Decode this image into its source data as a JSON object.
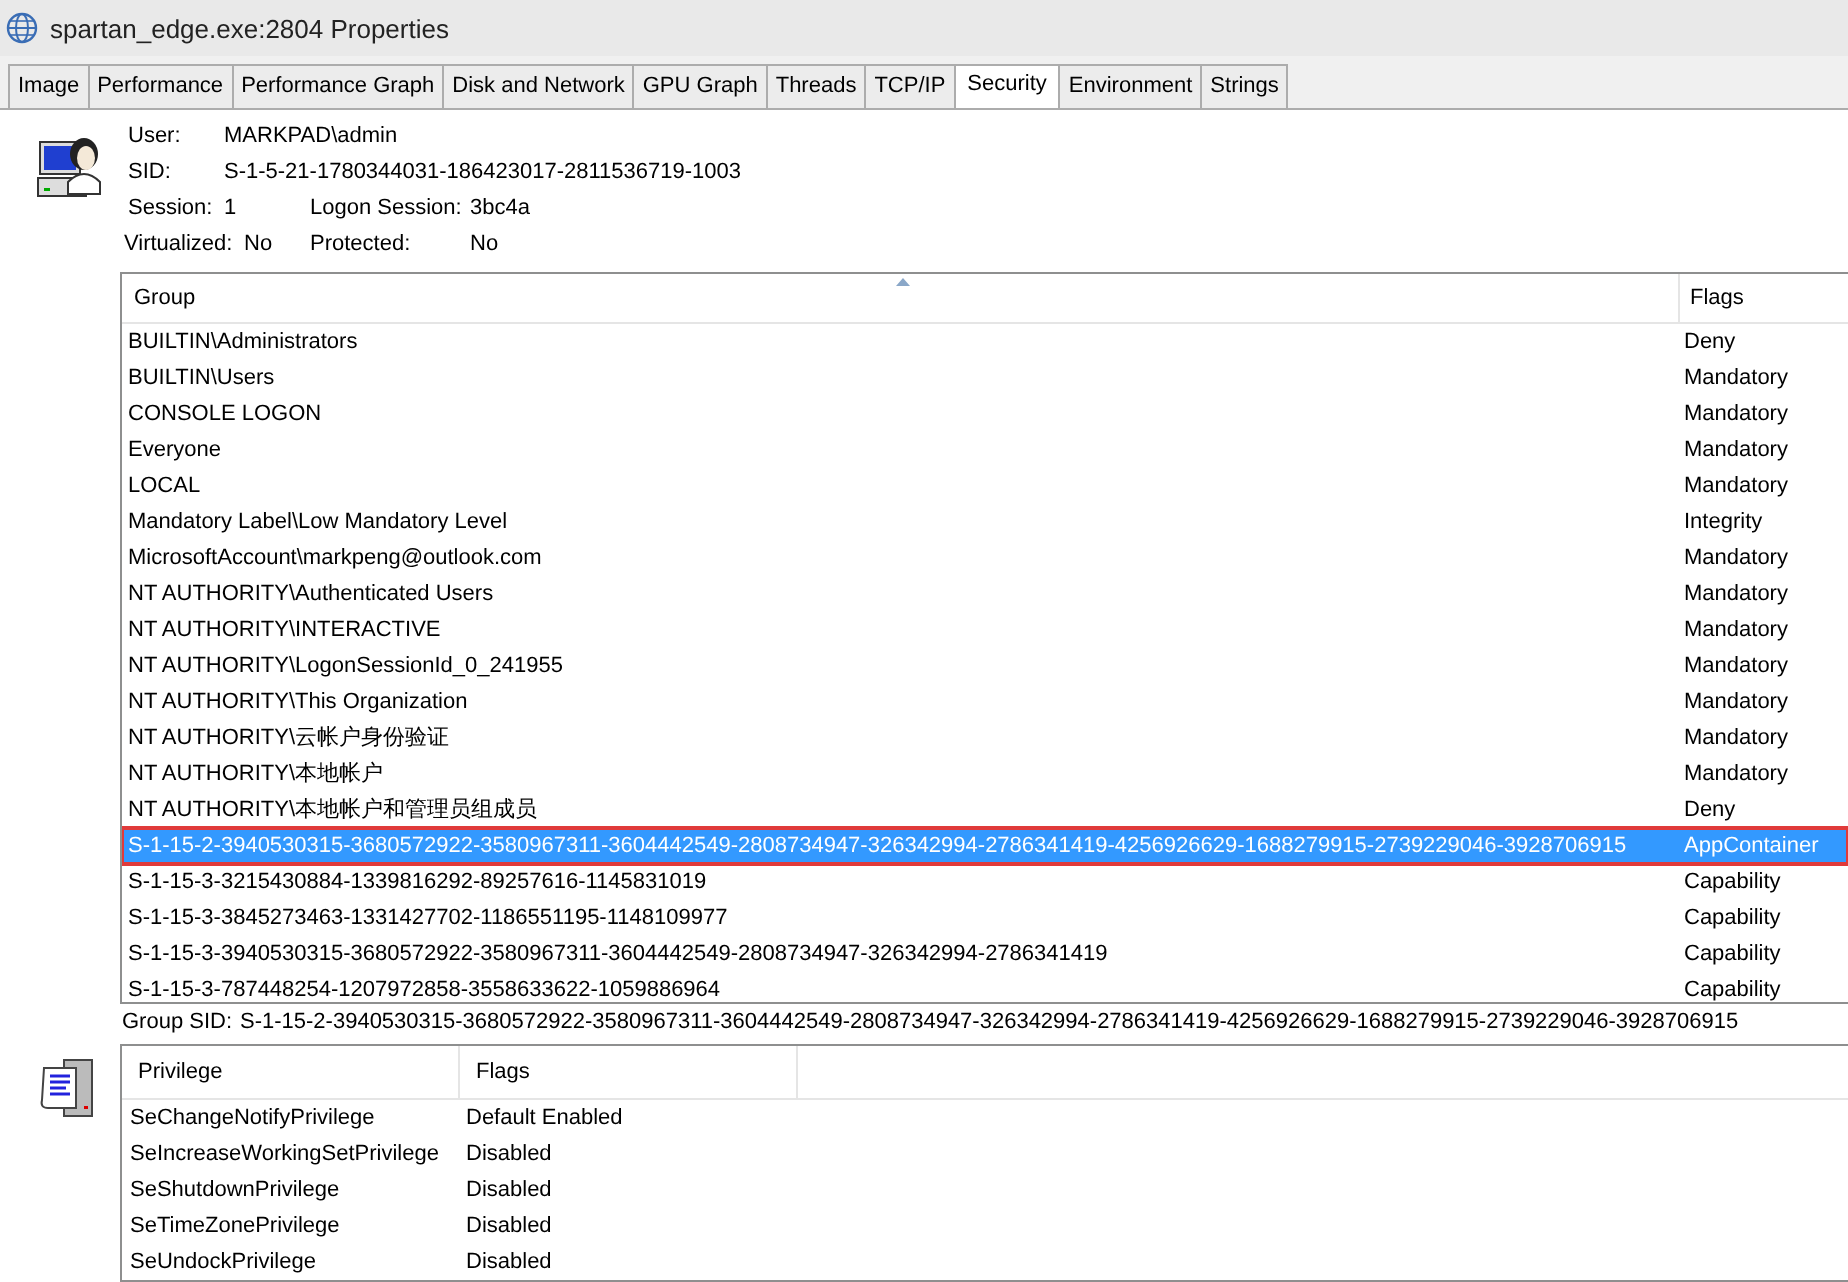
{
  "window": {
    "title": "spartan_edge.exe:2804 Properties"
  },
  "tabs": [
    {
      "label": "Image",
      "selected": false
    },
    {
      "label": "Performance",
      "selected": false
    },
    {
      "label": "Performance Graph",
      "selected": false
    },
    {
      "label": "Disk and Network",
      "selected": false
    },
    {
      "label": "GPU Graph",
      "selected": false
    },
    {
      "label": "Threads",
      "selected": false
    },
    {
      "label": "TCP/IP",
      "selected": false
    },
    {
      "label": "Security",
      "selected": true
    },
    {
      "label": "Environment",
      "selected": false
    },
    {
      "label": "Strings",
      "selected": false
    }
  ],
  "info": {
    "user_label": "User:",
    "user": "MARKPAD\\admin",
    "sid_label": "SID:",
    "sid": "S-1-5-21-1780344031-186423017-2811536719-1003",
    "session_label": "Session:",
    "session": "1",
    "logon_label": "Logon Session:",
    "logon": "3bc4a",
    "virtualized_label": "Virtualized:",
    "virtualized": "No",
    "protected_label": "Protected:",
    "protected": "No"
  },
  "groups": {
    "columns": [
      "Group",
      "Flags"
    ],
    "rows": [
      {
        "group": "BUILTIN\\Administrators",
        "flags": "Deny",
        "selected": false
      },
      {
        "group": "BUILTIN\\Users",
        "flags": "Mandatory",
        "selected": false
      },
      {
        "group": "CONSOLE LOGON",
        "flags": "Mandatory",
        "selected": false
      },
      {
        "group": "Everyone",
        "flags": "Mandatory",
        "selected": false
      },
      {
        "group": "LOCAL",
        "flags": "Mandatory",
        "selected": false
      },
      {
        "group": "Mandatory Label\\Low Mandatory Level",
        "flags": "Integrity",
        "selected": false
      },
      {
        "group": "MicrosoftAccount\\markpeng@outlook.com",
        "flags": "Mandatory",
        "selected": false
      },
      {
        "group": "NT AUTHORITY\\Authenticated Users",
        "flags": "Mandatory",
        "selected": false
      },
      {
        "group": "NT AUTHORITY\\INTERACTIVE",
        "flags": "Mandatory",
        "selected": false
      },
      {
        "group": "NT AUTHORITY\\LogonSessionId_0_241955",
        "flags": "Mandatory",
        "selected": false
      },
      {
        "group": "NT AUTHORITY\\This Organization",
        "flags": "Mandatory",
        "selected": false
      },
      {
        "group": "NT AUTHORITY\\云帐户身份验证",
        "flags": "Mandatory",
        "selected": false
      },
      {
        "group": "NT AUTHORITY\\本地帐户",
        "flags": "Mandatory",
        "selected": false
      },
      {
        "group": "NT AUTHORITY\\本地帐户和管理员组成员",
        "flags": "Deny",
        "selected": false
      },
      {
        "group": "S-1-15-2-3940530315-3680572922-3580967311-3604442549-2808734947-326342994-2786341419-4256926629-1688279915-2739229046-3928706915",
        "flags": "AppContainer",
        "selected": true
      },
      {
        "group": "S-1-15-3-3215430884-1339816292-89257616-1145831019",
        "flags": "Capability",
        "selected": false
      },
      {
        "group": "S-1-15-3-3845273463-1331427702-1186551195-1148109977",
        "flags": "Capability",
        "selected": false
      },
      {
        "group": "S-1-15-3-3940530315-3680572922-3580967311-3604442549-2808734947-326342994-2786341419",
        "flags": "Capability",
        "selected": false
      },
      {
        "group": "S-1-15-3-787448254-1207972858-3558633622-1059886964",
        "flags": "Capability",
        "selected": false
      }
    ]
  },
  "group_sid": {
    "label": "Group SID:",
    "value": "S-1-15-2-3940530315-3680572922-3580967311-3604442549-2808734947-326342994-2786341419-4256926629-1688279915-2739229046-3928706915"
  },
  "privileges": {
    "columns": [
      "Privilege",
      "Flags"
    ],
    "rows": [
      {
        "privilege": "SeChangeNotifyPrivilege",
        "flags": "Default Enabled"
      },
      {
        "privilege": "SeIncreaseWorkingSetPrivilege",
        "flags": "Disabled"
      },
      {
        "privilege": "SeShutdownPrivilege",
        "flags": "Disabled"
      },
      {
        "privilege": "SeTimeZonePrivilege",
        "flags": "Disabled"
      },
      {
        "privilege": "SeUndockPrivilege",
        "flags": "Disabled"
      }
    ]
  }
}
